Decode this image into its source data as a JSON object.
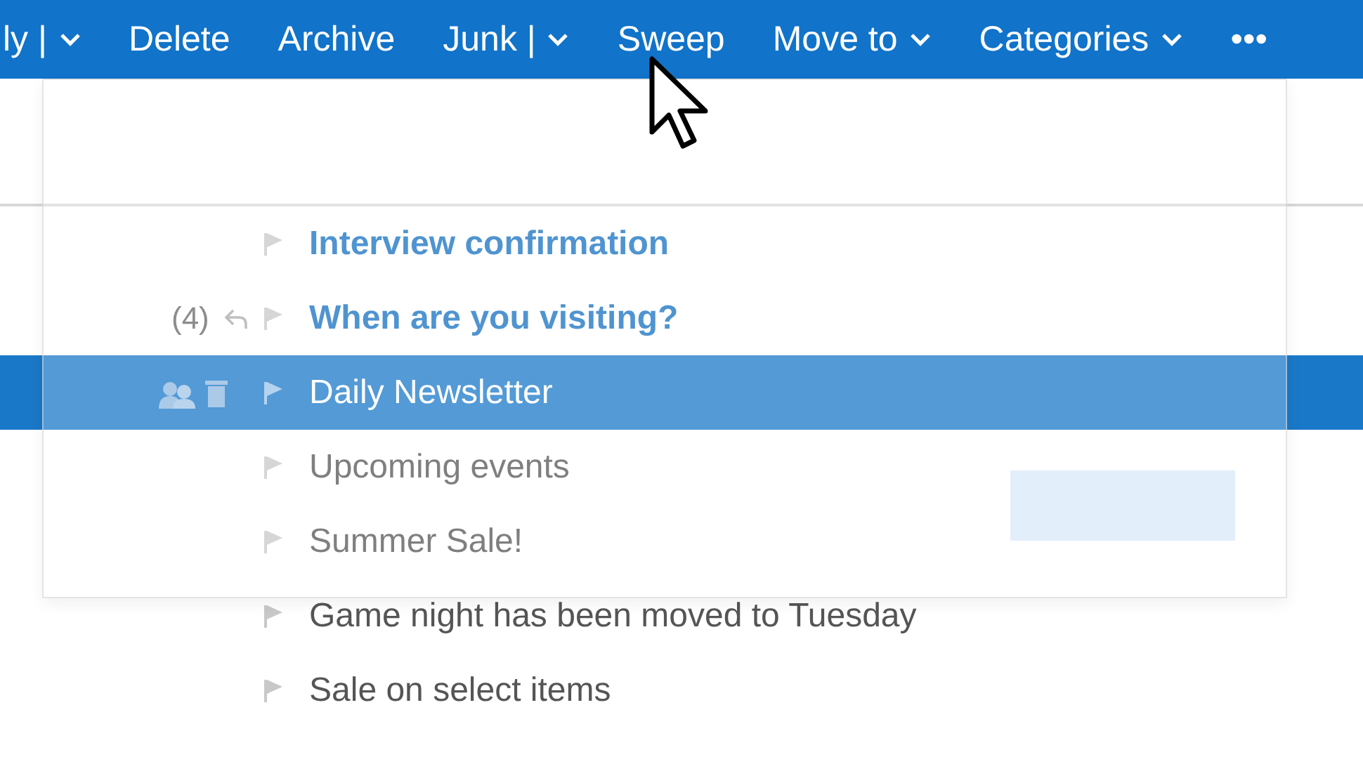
{
  "toolbar": {
    "items": [
      {
        "label": "ly |",
        "dropdown": true
      },
      {
        "label": "Delete",
        "dropdown": false
      },
      {
        "label": "Archive",
        "dropdown": false
      },
      {
        "label": "Junk |",
        "dropdown": true
      },
      {
        "label": "Sweep",
        "dropdown": false
      },
      {
        "label": "Move to",
        "dropdown": true
      },
      {
        "label": "Categories",
        "dropdown": true
      },
      {
        "label": "•••",
        "dropdown": false
      }
    ]
  },
  "messages": [
    {
      "replied": false,
      "unread": true,
      "selected": false,
      "subject": "Interview confirmation"
    },
    {
      "count": "(4)",
      "replied": true,
      "unread": true,
      "selected": false,
      "subject": "When are you visiting?"
    },
    {
      "replied": false,
      "unread": false,
      "selected": true,
      "subject": "Daily Newsletter"
    },
    {
      "replied": false,
      "unread": false,
      "selected": false,
      "subject": "Upcoming events"
    },
    {
      "replied": false,
      "unread": false,
      "selected": false,
      "subject": "Summer Sale!"
    },
    {
      "replied": false,
      "unread": false,
      "selected": false,
      "subject": "Game night has been moved to Tuesday"
    },
    {
      "replied": false,
      "unread": false,
      "selected": false,
      "subject": "Sale on select items"
    }
  ]
}
